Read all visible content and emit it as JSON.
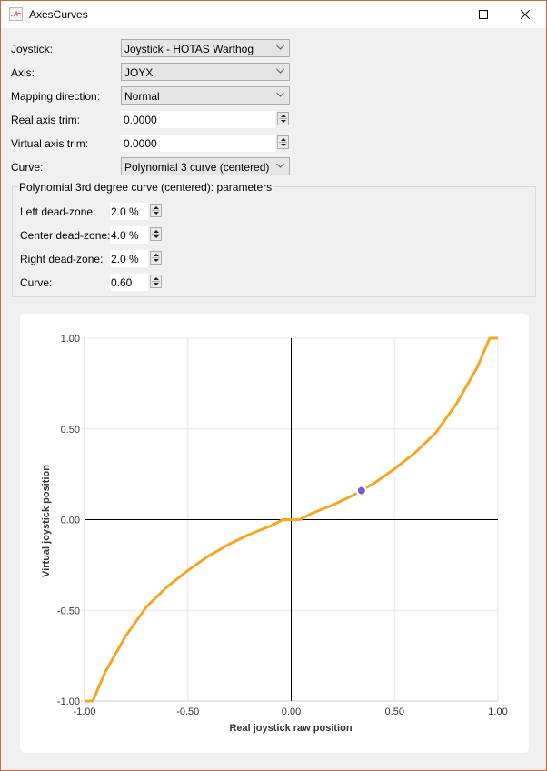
{
  "window": {
    "title": "AxesCurves",
    "controls": {
      "minimize": "minimize-icon",
      "maximize": "maximize-icon",
      "close": "close-icon"
    }
  },
  "form": {
    "joystick": {
      "label": "Joystick:",
      "value": "Joystick - HOTAS Warthog"
    },
    "axis": {
      "label": "Axis:",
      "value": "JOYX"
    },
    "mapping_direction": {
      "label": "Mapping direction:",
      "value": "Normal"
    },
    "real_axis_trim": {
      "label": "Real axis trim:",
      "value": "0.0000"
    },
    "virtual_axis_trim": {
      "label": "Virtual axis trim:",
      "value": "0.0000"
    },
    "curve": {
      "label": "Curve:",
      "value": "Polynomial 3 curve (centered)"
    }
  },
  "parameters": {
    "title": "Polynomial 3rd degree curve (centered): parameters",
    "left_dead_zone": {
      "label": "Left dead-zone:",
      "value": "2.0 %"
    },
    "center_dead_zone": {
      "label": "Center dead-zone:",
      "value": "4.0 %"
    },
    "right_dead_zone": {
      "label": "Right dead-zone:",
      "value": "2.0 %"
    },
    "curve": {
      "label": "Curve:",
      "value": "0.60"
    }
  },
  "colors": {
    "curve": "#f5a623",
    "marker": "#6a5fdb",
    "grid": "#e6e6e6",
    "axis": "#000000",
    "window_border": "#c9693a"
  },
  "chart_data": {
    "type": "line",
    "xlabel": "Real joystick raw position",
    "ylabel": "Virtual joystick position",
    "xlim": [
      -1,
      1
    ],
    "ylim": [
      -1,
      1
    ],
    "x_ticks": [
      "-1.00",
      "-0.50",
      "0.00",
      "0.50",
      "1.00"
    ],
    "y_ticks": [
      "1.00",
      "0.50",
      "0.00",
      "-0.50",
      "-1.00"
    ],
    "grid": true,
    "series": [
      {
        "name": "curve",
        "x": [
          -1.0,
          -0.96,
          -0.9,
          -0.8,
          -0.7,
          -0.6,
          -0.5,
          -0.4,
          -0.3,
          -0.2,
          -0.1,
          -0.04,
          0.0,
          0.04,
          0.1,
          0.2,
          0.3,
          0.4,
          0.5,
          0.6,
          0.7,
          0.8,
          0.9,
          0.96,
          1.0
        ],
        "y": [
          -1.0,
          -1.0,
          -0.84,
          -0.64,
          -0.48,
          -0.37,
          -0.28,
          -0.2,
          -0.135,
          -0.08,
          -0.035,
          0.0,
          0.0,
          0.0,
          0.035,
          0.08,
          0.135,
          0.2,
          0.28,
          0.37,
          0.48,
          0.64,
          0.84,
          1.0,
          1.0
        ]
      }
    ],
    "current_position": {
      "x": 0.34,
      "y": 0.16
    }
  }
}
